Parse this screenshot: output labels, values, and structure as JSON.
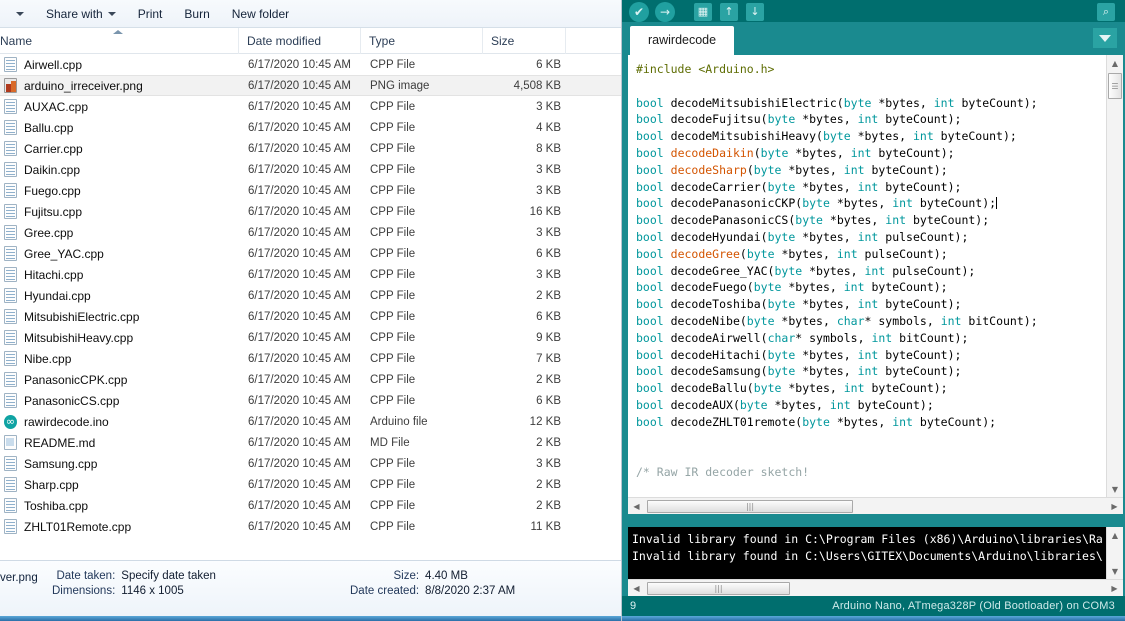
{
  "explorer": {
    "toolbar": {
      "nav_caret_label": "",
      "items": [
        {
          "label": "Share with",
          "has_caret": true
        },
        {
          "label": "Print",
          "has_caret": false
        },
        {
          "label": "Burn",
          "has_caret": false
        },
        {
          "label": "New folder",
          "has_caret": false
        }
      ]
    },
    "columns": [
      {
        "label": "Name",
        "sorted": true
      },
      {
        "label": "Date modified",
        "sorted": false
      },
      {
        "label": "Type",
        "sorted": false
      },
      {
        "label": "Size",
        "sorted": false
      }
    ],
    "files": [
      {
        "name": "Airwell.cpp",
        "date": "6/17/2020 10:45 AM",
        "type": "CPP File",
        "size": "6 KB",
        "icon": "cpp",
        "selected": false
      },
      {
        "name": "arduino_irreceiver.png",
        "date": "6/17/2020 10:45 AM",
        "type": "PNG image",
        "size": "4,508 KB",
        "icon": "png",
        "selected": true
      },
      {
        "name": "AUXAC.cpp",
        "date": "6/17/2020 10:45 AM",
        "type": "CPP File",
        "size": "3 KB",
        "icon": "cpp",
        "selected": false
      },
      {
        "name": "Ballu.cpp",
        "date": "6/17/2020 10:45 AM",
        "type": "CPP File",
        "size": "4 KB",
        "icon": "cpp",
        "selected": false
      },
      {
        "name": "Carrier.cpp",
        "date": "6/17/2020 10:45 AM",
        "type": "CPP File",
        "size": "8 KB",
        "icon": "cpp",
        "selected": false
      },
      {
        "name": "Daikin.cpp",
        "date": "6/17/2020 10:45 AM",
        "type": "CPP File",
        "size": "3 KB",
        "icon": "cpp",
        "selected": false
      },
      {
        "name": "Fuego.cpp",
        "date": "6/17/2020 10:45 AM",
        "type": "CPP File",
        "size": "3 KB",
        "icon": "cpp",
        "selected": false
      },
      {
        "name": "Fujitsu.cpp",
        "date": "6/17/2020 10:45 AM",
        "type": "CPP File",
        "size": "16 KB",
        "icon": "cpp",
        "selected": false
      },
      {
        "name": "Gree.cpp",
        "date": "6/17/2020 10:45 AM",
        "type": "CPP File",
        "size": "3 KB",
        "icon": "cpp",
        "selected": false
      },
      {
        "name": "Gree_YAC.cpp",
        "date": "6/17/2020 10:45 AM",
        "type": "CPP File",
        "size": "6 KB",
        "icon": "cpp",
        "selected": false
      },
      {
        "name": "Hitachi.cpp",
        "date": "6/17/2020 10:45 AM",
        "type": "CPP File",
        "size": "3 KB",
        "icon": "cpp",
        "selected": false
      },
      {
        "name": "Hyundai.cpp",
        "date": "6/17/2020 10:45 AM",
        "type": "CPP File",
        "size": "2 KB",
        "icon": "cpp",
        "selected": false
      },
      {
        "name": "MitsubishiElectric.cpp",
        "date": "6/17/2020 10:45 AM",
        "type": "CPP File",
        "size": "6 KB",
        "icon": "cpp",
        "selected": false
      },
      {
        "name": "MitsubishiHeavy.cpp",
        "date": "6/17/2020 10:45 AM",
        "type": "CPP File",
        "size": "9 KB",
        "icon": "cpp",
        "selected": false
      },
      {
        "name": "Nibe.cpp",
        "date": "6/17/2020 10:45 AM",
        "type": "CPP File",
        "size": "7 KB",
        "icon": "cpp",
        "selected": false
      },
      {
        "name": "PanasonicCPK.cpp",
        "date": "6/17/2020 10:45 AM",
        "type": "CPP File",
        "size": "2 KB",
        "icon": "cpp",
        "selected": false
      },
      {
        "name": "PanasonicCS.cpp",
        "date": "6/17/2020 10:45 AM",
        "type": "CPP File",
        "size": "6 KB",
        "icon": "cpp",
        "selected": false
      },
      {
        "name": "rawirdecode.ino",
        "date": "6/17/2020 10:45 AM",
        "type": "Arduino file",
        "size": "12 KB",
        "icon": "ino",
        "selected": false
      },
      {
        "name": "README.md",
        "date": "6/17/2020 10:45 AM",
        "type": "MD File",
        "size": "2 KB",
        "icon": "md",
        "selected": false
      },
      {
        "name": "Samsung.cpp",
        "date": "6/17/2020 10:45 AM",
        "type": "CPP File",
        "size": "3 KB",
        "icon": "cpp",
        "selected": false
      },
      {
        "name": "Sharp.cpp",
        "date": "6/17/2020 10:45 AM",
        "type": "CPP File",
        "size": "2 KB",
        "icon": "cpp",
        "selected": false
      },
      {
        "name": "Toshiba.cpp",
        "date": "6/17/2020 10:45 AM",
        "type": "CPP File",
        "size": "2 KB",
        "icon": "cpp",
        "selected": false
      },
      {
        "name": "ZHLT01Remote.cpp",
        "date": "6/17/2020 10:45 AM",
        "type": "CPP File",
        "size": "11 KB",
        "icon": "cpp",
        "selected": false
      }
    ],
    "details": {
      "filename_fragment": "ver.png",
      "date_taken_label": "Date taken:",
      "date_taken_value": "Specify date taken",
      "dimensions_label": "Dimensions:",
      "dimensions_value": "1146 x 1005",
      "size_label": "Size:",
      "size_value": "4.40 MB",
      "date_created_label": "Date created:",
      "date_created_value": "8/8/2020 2:37 AM"
    }
  },
  "ide": {
    "toolbar": {
      "verify": "✔",
      "upload": "→",
      "new": "▦",
      "open": "↑",
      "save": "↓",
      "serial_monitor": "⌕"
    },
    "tab": {
      "label": "rawirdecode"
    },
    "code_lines": [
      [
        {
          "t": "#include ",
          "c": "pre"
        },
        {
          "t": "<Arduino.h>",
          "c": "pre"
        }
      ],
      [
        {
          "t": "",
          "c": ""
        }
      ],
      [
        {
          "t": "bool",
          "c": "kw"
        },
        {
          "t": " decodeMitsubishiElectric(",
          "c": ""
        },
        {
          "t": "byte",
          "c": "kw"
        },
        {
          "t": " *bytes, ",
          "c": ""
        },
        {
          "t": "int",
          "c": "kw"
        },
        {
          "t": " byteCount);",
          "c": ""
        }
      ],
      [
        {
          "t": "bool",
          "c": "kw"
        },
        {
          "t": " decodeFujitsu(",
          "c": ""
        },
        {
          "t": "byte",
          "c": "kw"
        },
        {
          "t": " *bytes, ",
          "c": ""
        },
        {
          "t": "int",
          "c": "kw"
        },
        {
          "t": " byteCount);",
          "c": ""
        }
      ],
      [
        {
          "t": "bool",
          "c": "kw"
        },
        {
          "t": " decodeMitsubishiHeavy(",
          "c": ""
        },
        {
          "t": "byte",
          "c": "kw"
        },
        {
          "t": " *bytes, ",
          "c": ""
        },
        {
          "t": "int",
          "c": "kw"
        },
        {
          "t": " byteCount);",
          "c": ""
        }
      ],
      [
        {
          "t": "bool",
          "c": "kw"
        },
        {
          "t": " ",
          "c": ""
        },
        {
          "t": "decodeDaikin",
          "c": "fn"
        },
        {
          "t": "(",
          "c": ""
        },
        {
          "t": "byte",
          "c": "kw"
        },
        {
          "t": " *bytes, ",
          "c": ""
        },
        {
          "t": "int",
          "c": "kw"
        },
        {
          "t": " byteCount);",
          "c": ""
        }
      ],
      [
        {
          "t": "bool",
          "c": "kw"
        },
        {
          "t": " ",
          "c": ""
        },
        {
          "t": "decodeSharp",
          "c": "fn"
        },
        {
          "t": "(",
          "c": ""
        },
        {
          "t": "byte",
          "c": "kw"
        },
        {
          "t": " *bytes, ",
          "c": ""
        },
        {
          "t": "int",
          "c": "kw"
        },
        {
          "t": " byteCount);",
          "c": ""
        }
      ],
      [
        {
          "t": "bool",
          "c": "kw"
        },
        {
          "t": " decodeCarrier(",
          "c": ""
        },
        {
          "t": "byte",
          "c": "kw"
        },
        {
          "t": " *bytes, ",
          "c": ""
        },
        {
          "t": "int",
          "c": "kw"
        },
        {
          "t": " byteCount);",
          "c": ""
        }
      ],
      [
        {
          "t": "bool",
          "c": "kw"
        },
        {
          "t": " decodePanasonicCKP(",
          "c": ""
        },
        {
          "t": "byte",
          "c": "kw"
        },
        {
          "t": " *bytes, ",
          "c": ""
        },
        {
          "t": "int",
          "c": "kw"
        },
        {
          "t": " byteCount);",
          "c": ""
        },
        {
          "t": "CURSOR",
          "c": "cursor"
        }
      ],
      [
        {
          "t": "bool",
          "c": "kw"
        },
        {
          "t": " decodePanasonicCS(",
          "c": ""
        },
        {
          "t": "byte",
          "c": "kw"
        },
        {
          "t": " *bytes, ",
          "c": ""
        },
        {
          "t": "int",
          "c": "kw"
        },
        {
          "t": " byteCount);",
          "c": ""
        }
      ],
      [
        {
          "t": "bool",
          "c": "kw"
        },
        {
          "t": " decodeHyundai(",
          "c": ""
        },
        {
          "t": "byte",
          "c": "kw"
        },
        {
          "t": " *bytes, ",
          "c": ""
        },
        {
          "t": "int",
          "c": "kw"
        },
        {
          "t": " pulseCount);",
          "c": ""
        }
      ],
      [
        {
          "t": "bool",
          "c": "kw"
        },
        {
          "t": " ",
          "c": ""
        },
        {
          "t": "decodeGree",
          "c": "fn"
        },
        {
          "t": "(",
          "c": ""
        },
        {
          "t": "byte",
          "c": "kw"
        },
        {
          "t": " *bytes, ",
          "c": ""
        },
        {
          "t": "int",
          "c": "kw"
        },
        {
          "t": " pulseCount);",
          "c": ""
        }
      ],
      [
        {
          "t": "bool",
          "c": "kw"
        },
        {
          "t": " decodeGree_YAC(",
          "c": ""
        },
        {
          "t": "byte",
          "c": "kw"
        },
        {
          "t": " *bytes, ",
          "c": ""
        },
        {
          "t": "int",
          "c": "kw"
        },
        {
          "t": " pulseCount);",
          "c": ""
        }
      ],
      [
        {
          "t": "bool",
          "c": "kw"
        },
        {
          "t": " decodeFuego(",
          "c": ""
        },
        {
          "t": "byte",
          "c": "kw"
        },
        {
          "t": " *bytes, ",
          "c": ""
        },
        {
          "t": "int",
          "c": "kw"
        },
        {
          "t": " byteCount);",
          "c": ""
        }
      ],
      [
        {
          "t": "bool",
          "c": "kw"
        },
        {
          "t": " decodeToshiba(",
          "c": ""
        },
        {
          "t": "byte",
          "c": "kw"
        },
        {
          "t": " *bytes, ",
          "c": ""
        },
        {
          "t": "int",
          "c": "kw"
        },
        {
          "t": " byteCount);",
          "c": ""
        }
      ],
      [
        {
          "t": "bool",
          "c": "kw"
        },
        {
          "t": " decodeNibe(",
          "c": ""
        },
        {
          "t": "byte",
          "c": "kw"
        },
        {
          "t": " *bytes, ",
          "c": ""
        },
        {
          "t": "char",
          "c": "kw"
        },
        {
          "t": "* symbols, ",
          "c": ""
        },
        {
          "t": "int",
          "c": "kw"
        },
        {
          "t": " bitCount);",
          "c": ""
        }
      ],
      [
        {
          "t": "bool",
          "c": "kw"
        },
        {
          "t": " decodeAirwell(",
          "c": ""
        },
        {
          "t": "char",
          "c": "kw"
        },
        {
          "t": "* symbols, ",
          "c": ""
        },
        {
          "t": "int",
          "c": "kw"
        },
        {
          "t": " bitCount);",
          "c": ""
        }
      ],
      [
        {
          "t": "bool",
          "c": "kw"
        },
        {
          "t": " decodeHitachi(",
          "c": ""
        },
        {
          "t": "byte",
          "c": "kw"
        },
        {
          "t": " *bytes, ",
          "c": ""
        },
        {
          "t": "int",
          "c": "kw"
        },
        {
          "t": " byteCount);",
          "c": ""
        }
      ],
      [
        {
          "t": "bool",
          "c": "kw"
        },
        {
          "t": " decodeSamsung(",
          "c": ""
        },
        {
          "t": "byte",
          "c": "kw"
        },
        {
          "t": " *bytes, ",
          "c": ""
        },
        {
          "t": "int",
          "c": "kw"
        },
        {
          "t": " byteCount);",
          "c": ""
        }
      ],
      [
        {
          "t": "bool",
          "c": "kw"
        },
        {
          "t": " decodeBallu(",
          "c": ""
        },
        {
          "t": "byte",
          "c": "kw"
        },
        {
          "t": " *bytes, ",
          "c": ""
        },
        {
          "t": "int",
          "c": "kw"
        },
        {
          "t": " byteCount);",
          "c": ""
        }
      ],
      [
        {
          "t": "bool",
          "c": "kw"
        },
        {
          "t": " decodeAUX(",
          "c": ""
        },
        {
          "t": "byte",
          "c": "kw"
        },
        {
          "t": " *bytes, ",
          "c": ""
        },
        {
          "t": "int",
          "c": "kw"
        },
        {
          "t": " byteCount);",
          "c": ""
        }
      ],
      [
        {
          "t": "bool",
          "c": "kw"
        },
        {
          "t": " decodeZHLT01remote(",
          "c": ""
        },
        {
          "t": "byte",
          "c": "kw"
        },
        {
          "t": " *bytes, ",
          "c": ""
        },
        {
          "t": "int",
          "c": "kw"
        },
        {
          "t": " byteCount);",
          "c": ""
        }
      ],
      [
        {
          "t": "",
          "c": ""
        }
      ],
      [
        {
          "t": "",
          "c": ""
        }
      ],
      [
        {
          "t": "/* Raw IR decoder sketch!",
          "c": "cmt"
        }
      ]
    ],
    "console_lines": [
      "Invalid library found in C:\\Program Files (x86)\\Arduino\\libraries\\Ra",
      "Invalid library found in C:\\Users\\GITEX\\Documents\\Arduino\\libraries\\"
    ],
    "statusbar": {
      "line_number": "9",
      "board_info": "Arduino Nano, ATmega328P (Old Bootloader) on COM3"
    },
    "colors": {
      "teal": "#1a8a8f",
      "teal_dark": "#006e6e",
      "keyword": "#00979c",
      "function": "#d35400",
      "preprocessor": "#5e6d03",
      "comment": "#95a5a6"
    }
  }
}
